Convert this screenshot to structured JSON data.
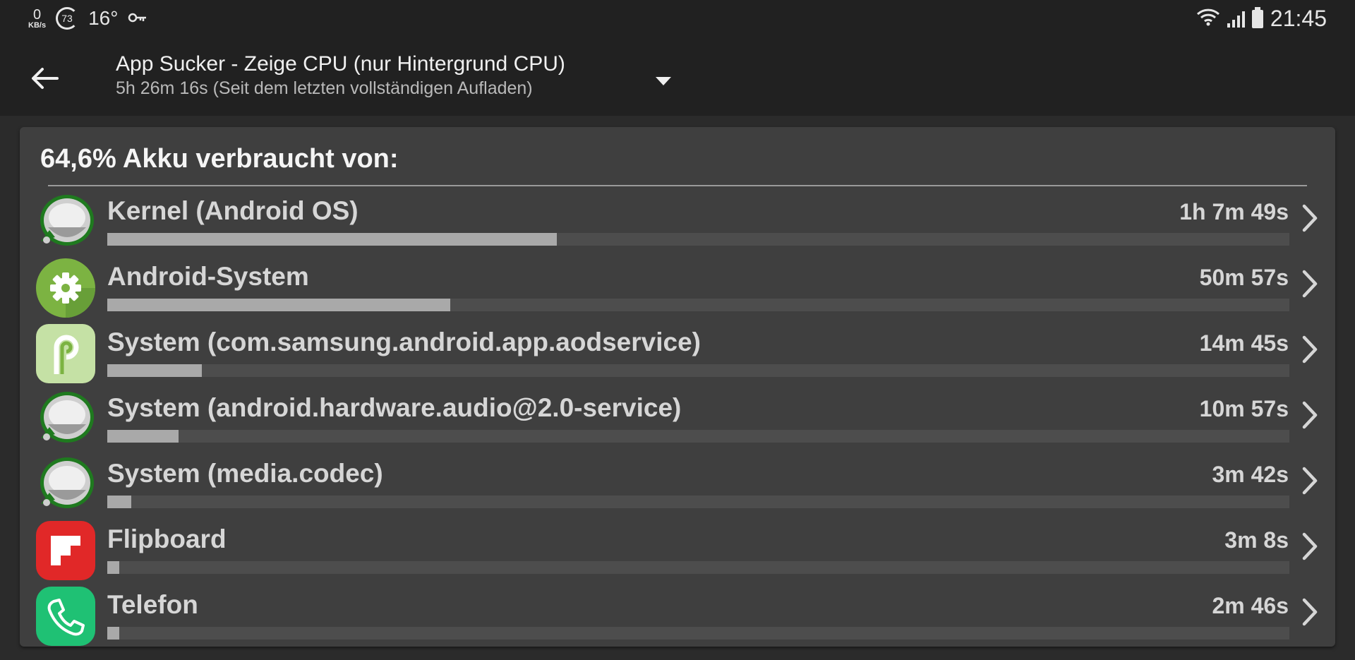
{
  "status_bar": {
    "net_speed_value": "0",
    "net_speed_unit": "KB/s",
    "ring_value": "73",
    "temperature": "16°",
    "time": "21:45",
    "icons": [
      "key-icon",
      "wifi-icon",
      "signal-icon",
      "battery-icon"
    ]
  },
  "toolbar": {
    "title": "App Sucker - Zeige CPU (nur Hintergrund CPU)",
    "subtitle": "5h 26m 16s (Seit dem letzten vollständigen Aufladen)",
    "back_icon": "arrow-left-icon",
    "dropdown_icon": "caret-down-icon"
  },
  "card": {
    "header": "64,6% Akku verbraucht von:",
    "rows": [
      {
        "name": "Kernel (Android OS)",
        "time": "1h 7m 49s",
        "icon": "kernel-icon",
        "fraction": 0.38
      },
      {
        "name": "Android-System",
        "time": "50m 57s",
        "icon": "android-settings-icon",
        "fraction": 0.29
      },
      {
        "name": "System (com.samsung.android.app.aodservice)",
        "time": "14m 45s",
        "icon": "android-pie-icon",
        "fraction": 0.08
      },
      {
        "name": "System (android.hardware.audio@2.0-service)",
        "time": "10m 57s",
        "icon": "kernel-icon",
        "fraction": 0.06
      },
      {
        "name": "System (media.codec)",
        "time": "3m 42s",
        "icon": "kernel-icon",
        "fraction": 0.02
      },
      {
        "name": "Flipboard",
        "time": "3m 8s",
        "icon": "flipboard-icon",
        "fraction": 0.01
      },
      {
        "name": "Telefon",
        "time": "2m 46s",
        "icon": "phone-icon",
        "fraction": 0.01
      }
    ]
  },
  "colors": {
    "background": "#2b2b2b",
    "bar_fill": "#a9a9a9",
    "flipboard_red": "#e12828",
    "android_green": "#7cb342",
    "phone_green": "#1fc174"
  }
}
